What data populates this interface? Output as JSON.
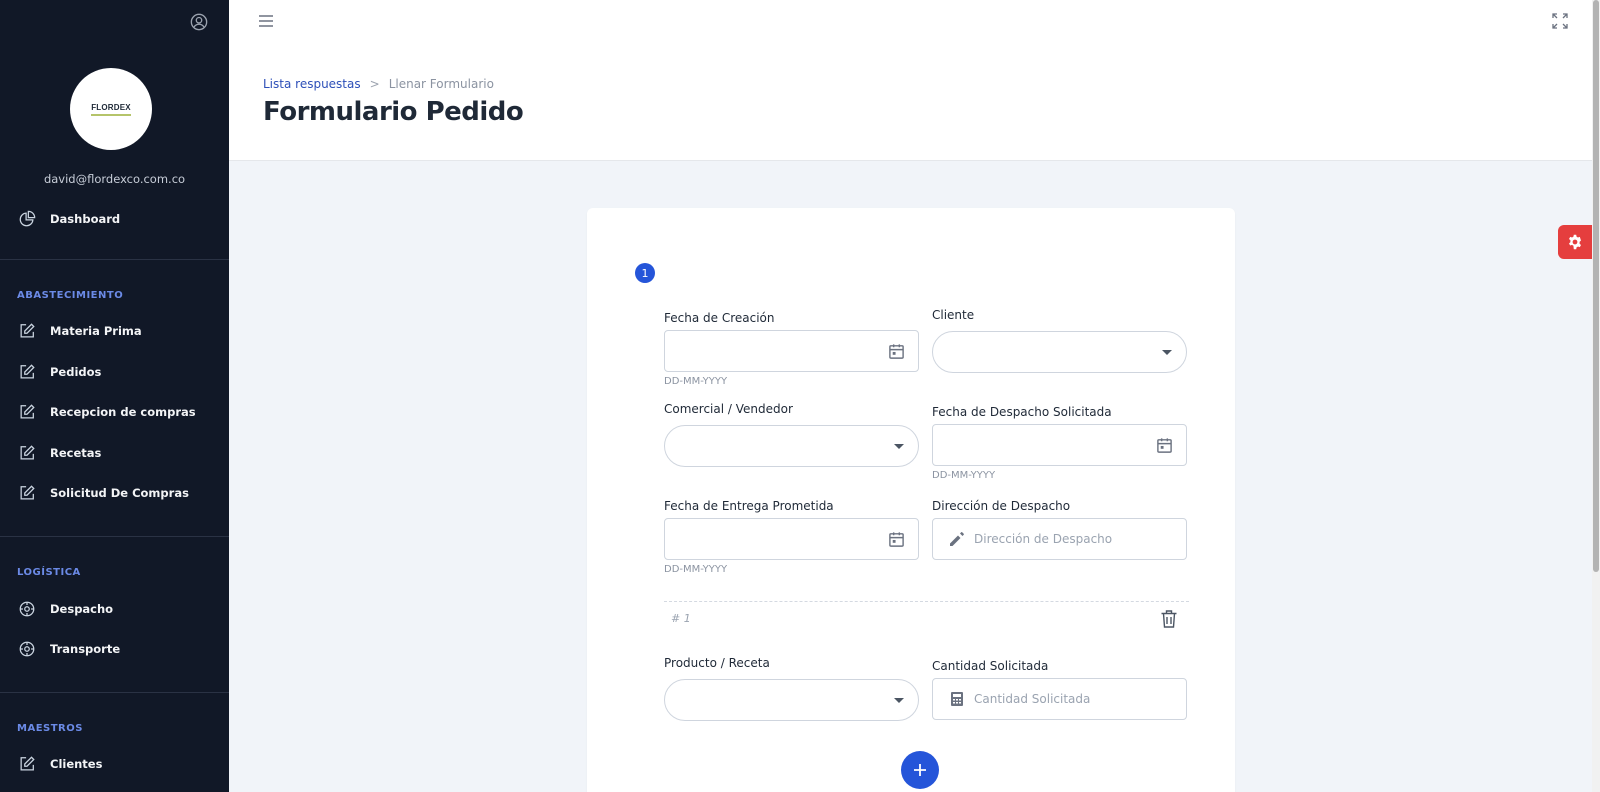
{
  "sidebar": {
    "logo_text": "FLORDEX",
    "email": "david@flordexco.com.co",
    "dashboard": "Dashboard",
    "sections": [
      {
        "title": "ABASTECIMIENTO",
        "items": [
          "Materia Prima",
          "Pedidos",
          "Recepcion de compras",
          "Recetas",
          "Solicitud De Compras"
        ]
      },
      {
        "title": "LOGÍSTICA",
        "items": [
          "Despacho",
          "Transporte"
        ]
      },
      {
        "title": "MAESTROS",
        "items": [
          "Clientes"
        ]
      }
    ]
  },
  "header": {
    "breadcrumb_link": "Lista respuestas",
    "breadcrumb_sep": ">",
    "breadcrumb_current": "Llenar Formulario",
    "title": "Formulario Pedido"
  },
  "form": {
    "step": "1",
    "fecha_creacion": {
      "label": "Fecha de Creación",
      "hint": "DD-MM-YYYY",
      "value": ""
    },
    "cliente": {
      "label": "Cliente",
      "value": ""
    },
    "comercial": {
      "label": "Comercial / Vendedor",
      "value": ""
    },
    "fecha_despacho": {
      "label": "Fecha de Despacho Solicitada",
      "hint": "DD-MM-YYYY",
      "value": ""
    },
    "fecha_entrega": {
      "label": "Fecha de Entrega Prometida",
      "hint": "DD-MM-YYYY",
      "value": ""
    },
    "direccion": {
      "label": "Dirección de Despacho",
      "placeholder": "Dirección de Despacho"
    },
    "item_number": "# 1",
    "producto": {
      "label": "Producto / Receta",
      "value": ""
    },
    "cantidad": {
      "label": "Cantidad Solicitada",
      "placeholder": "Cantidad Solicitada"
    }
  },
  "colors": {
    "sidebar_bg": "#111827",
    "accent": "#2555d9",
    "settings": "#e53e3e",
    "section_title": "#6b8ae6"
  },
  "icons": [
    "user-circle-icon",
    "pie-chart-icon",
    "edit-icon",
    "gear-outline-icon",
    "hamburger-icon",
    "fullscreen-icon",
    "calendar-icon",
    "pencil-icon",
    "calculator-icon",
    "trash-icon",
    "plus-icon",
    "settings-icon"
  ]
}
